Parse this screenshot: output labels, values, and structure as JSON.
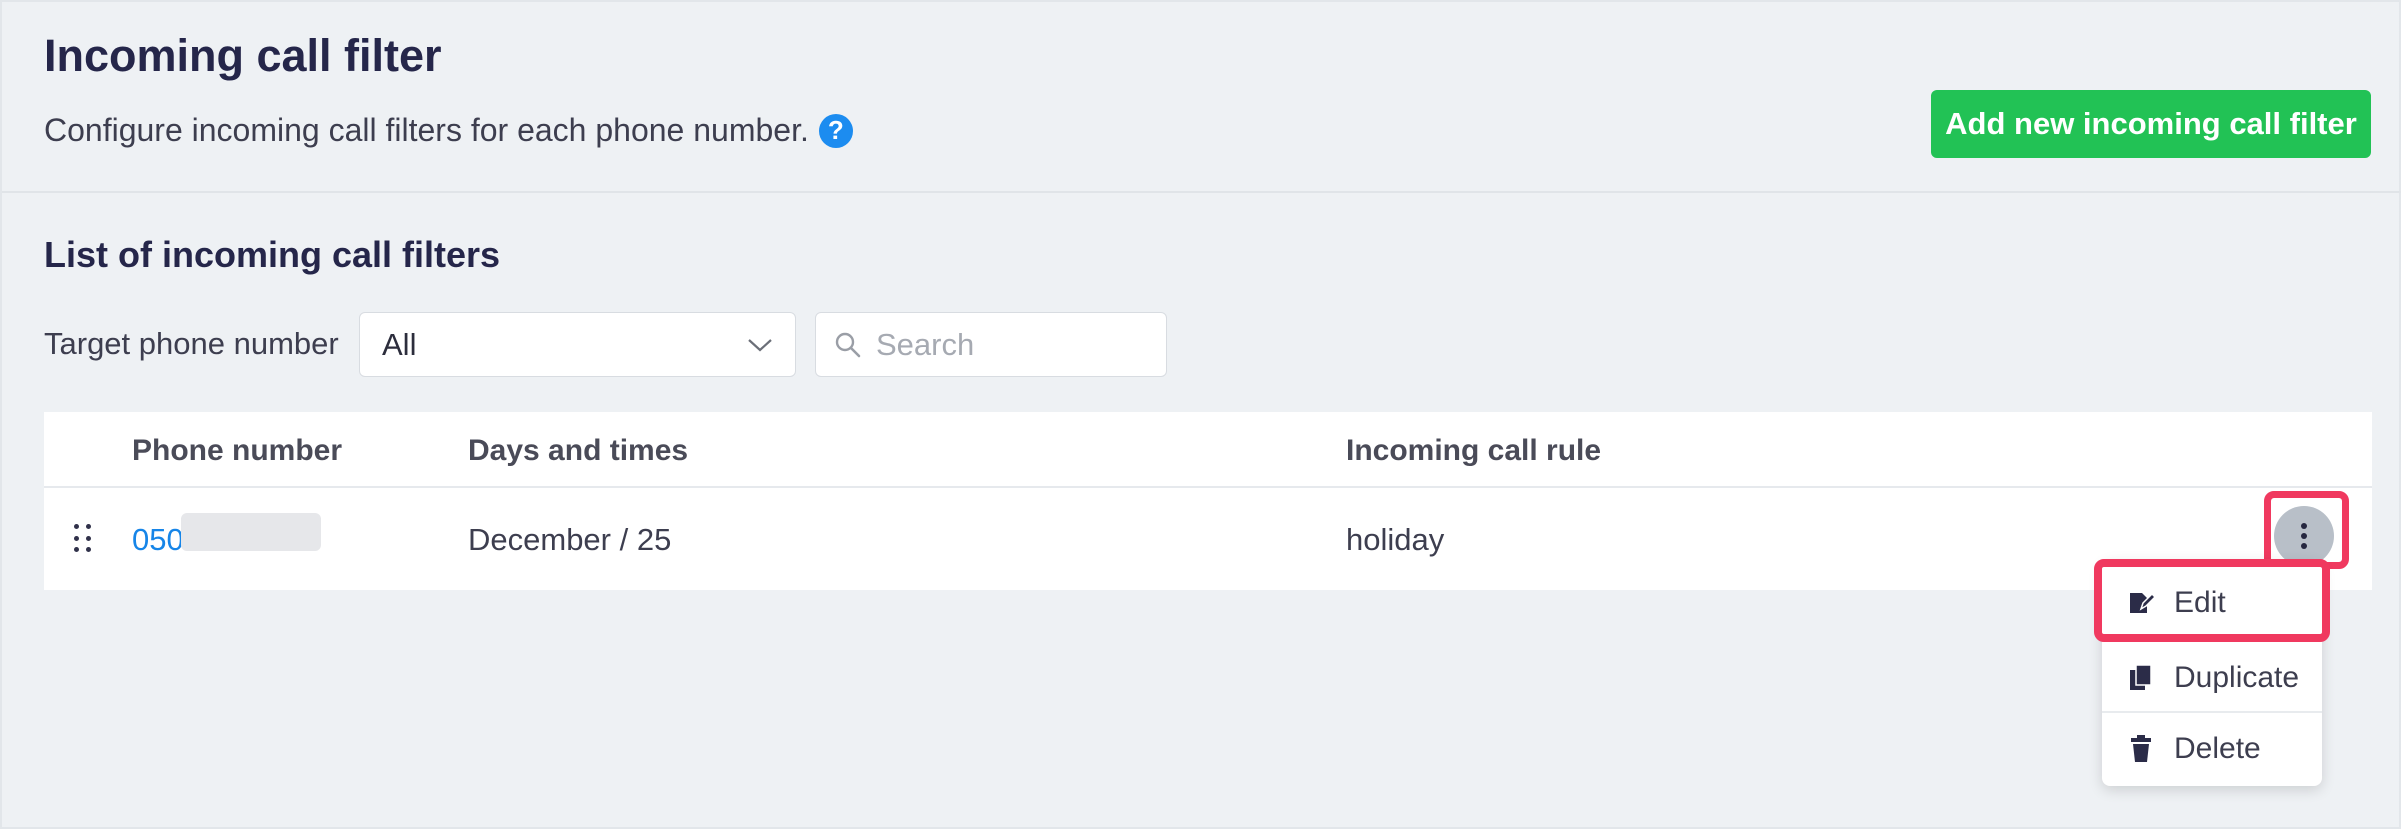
{
  "header": {
    "title": "Incoming call filter",
    "subtitle": "Configure incoming call filters for each phone number.",
    "help_icon_glyph": "?",
    "add_button_label": "Add new incoming call filter"
  },
  "list": {
    "title": "List of incoming call filters",
    "filter_label": "Target phone number",
    "select_value": "All",
    "search_placeholder": "Search",
    "search_value": ""
  },
  "table": {
    "columns": [
      "Phone number",
      "Days and times",
      "Incoming call rule"
    ],
    "rows": [
      {
        "phone_number_prefix": "050",
        "days_and_times": "December / 25",
        "incoming_call_rule": "holiday"
      }
    ]
  },
  "row_menu": {
    "items": [
      {
        "label": "Edit",
        "icon": "edit-icon"
      },
      {
        "label": "Duplicate",
        "icon": "duplicate-icon"
      },
      {
        "label": "Delete",
        "icon": "trash-icon"
      }
    ]
  },
  "colors": {
    "accent_green": "#22c255",
    "link_blue": "#1685e8",
    "help_blue": "#1c8cf0",
    "highlight_red": "#f0395f",
    "title_navy": "#25264a"
  }
}
